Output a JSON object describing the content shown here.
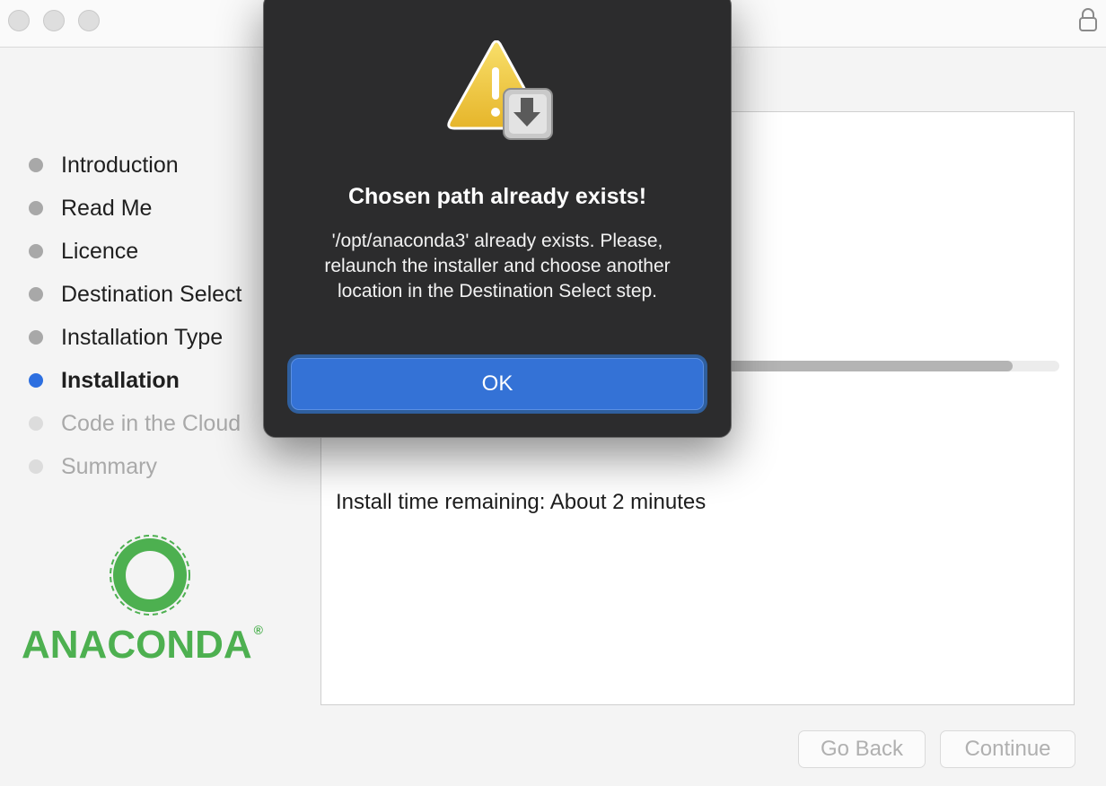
{
  "sidebar": {
    "steps": [
      {
        "label": "Introduction",
        "state": "done"
      },
      {
        "label": "Read Me",
        "state": "done"
      },
      {
        "label": "Licence",
        "state": "done"
      },
      {
        "label": "Destination Select",
        "state": "done"
      },
      {
        "label": "Installation Type",
        "state": "done"
      },
      {
        "label": "Installation",
        "state": "active"
      },
      {
        "label": "Code in the Cloud",
        "state": "future"
      },
      {
        "label": "Summary",
        "state": "future"
      }
    ],
    "logo_text": "ANACONDA",
    "logo_mark": "®"
  },
  "main": {
    "progress_fraction": 0.93,
    "remaining_text": "Install time remaining: About 2 minutes"
  },
  "footer": {
    "back_label": "Go Back",
    "continue_label": "Continue"
  },
  "alert": {
    "icon": "warning-disk-icon",
    "title": "Chosen path already exists!",
    "message": "'/opt/anaconda3' already exists. Please, relaunch the installer and choose another location in the Destination Select step.",
    "ok_label": "OK"
  },
  "colors": {
    "accent": "#3472d6",
    "active_dot": "#2d6fe0",
    "logo_green": "#4db050",
    "alert_bg": "#2c2c2d"
  }
}
